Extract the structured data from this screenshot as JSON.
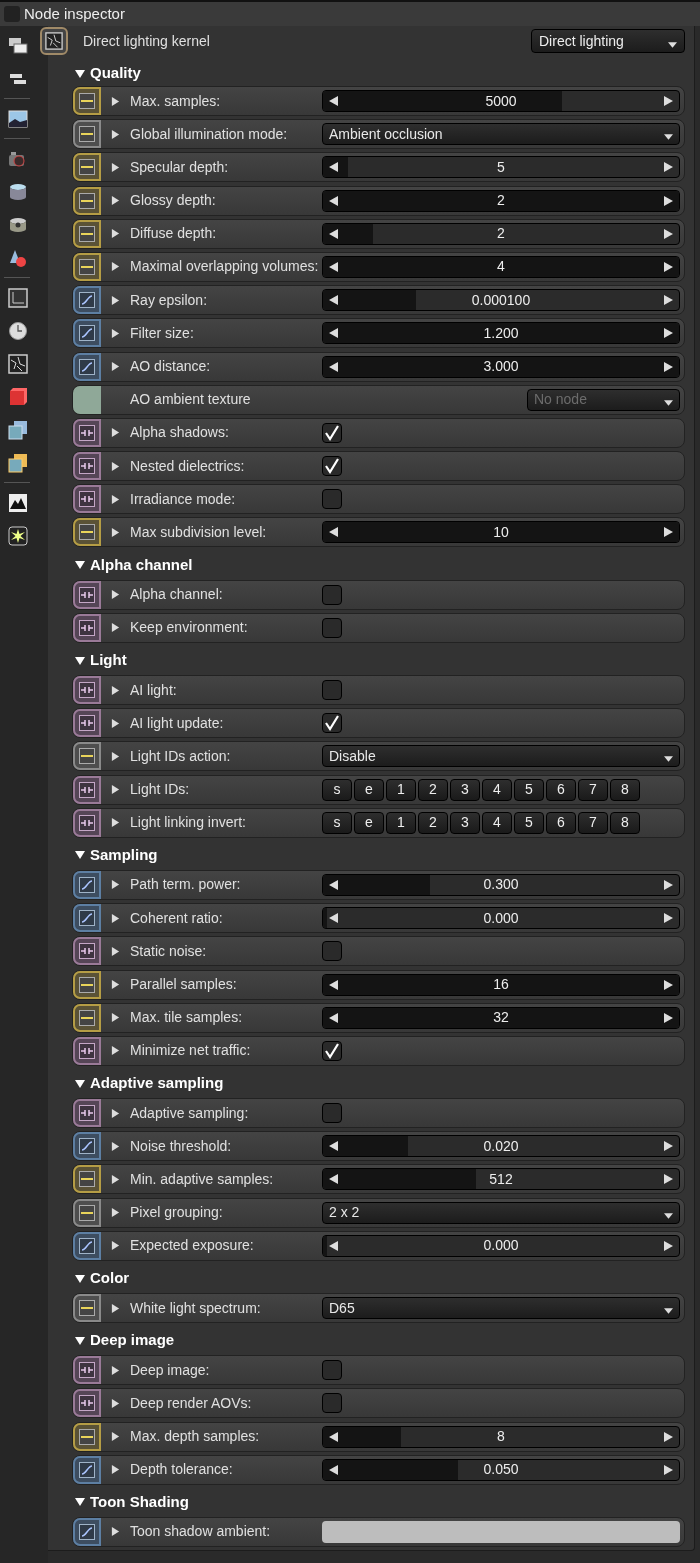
{
  "window": {
    "title": "Node inspector"
  },
  "node": {
    "title": "Direct lighting kernel",
    "type": "Direct lighting"
  },
  "sections": [
    {
      "title": "Quality",
      "expanded": true,
      "rows": [
        {
          "kind": "slider",
          "pin": {
            "kind": "int"
          },
          "label": "Max. samples:",
          "value": "5000",
          "level": 0.67
        },
        {
          "kind": "dropdown",
          "pin": {
            "kind": "enum"
          },
          "label": "Global illumination mode:",
          "value": "Ambient occlusion",
          "disabled": false
        },
        {
          "kind": "slider",
          "pin": {
            "kind": "int"
          },
          "label": "Specular depth:",
          "value": "5",
          "level": 0.07
        },
        {
          "kind": "slider",
          "pin": {
            "kind": "int"
          },
          "label": "Glossy depth:",
          "value": "2",
          "level": 1
        },
        {
          "kind": "slider",
          "pin": {
            "kind": "int"
          },
          "label": "Diffuse depth:",
          "value": "2",
          "level": 0.14
        },
        {
          "kind": "slider",
          "pin": {
            "kind": "int"
          },
          "label": "Maximal overlapping volumes:",
          "value": "4",
          "level": 1
        },
        {
          "kind": "slider",
          "pin": {
            "kind": "float"
          },
          "label": "Ray epsilon:",
          "value": "0.000100",
          "level": 0.26
        },
        {
          "kind": "slider",
          "pin": {
            "kind": "float"
          },
          "label": "Filter size:",
          "value": "1.200",
          "level": 1
        },
        {
          "kind": "slider",
          "pin": {
            "kind": "float"
          },
          "label": "AO distance:",
          "value": "3.000",
          "level": 1
        },
        {
          "kind": "texture",
          "pin": {
            "kind": "texture"
          },
          "label": "AO ambient texture",
          "value": "No node",
          "disabled": true
        },
        {
          "kind": "checkbox",
          "pin": {
            "kind": "bool"
          },
          "label": "Alpha shadows:",
          "checked": true
        },
        {
          "kind": "checkbox",
          "pin": {
            "kind": "bool"
          },
          "label": "Nested dielectrics:",
          "checked": true
        },
        {
          "kind": "checkbox",
          "pin": {
            "kind": "bool"
          },
          "label": "Irradiance mode:",
          "checked": false
        },
        {
          "kind": "slider",
          "pin": {
            "kind": "int"
          },
          "label": "Max subdivision level:",
          "value": "10",
          "level": 1
        }
      ]
    },
    {
      "title": "Alpha channel",
      "expanded": true,
      "rows": [
        {
          "kind": "checkbox",
          "pin": {
            "kind": "bool"
          },
          "label": "Alpha channel:",
          "checked": false
        },
        {
          "kind": "checkbox",
          "pin": {
            "kind": "bool"
          },
          "label": "Keep environment:",
          "checked": false
        }
      ]
    },
    {
      "title": "Light",
      "expanded": true,
      "rows": [
        {
          "kind": "checkbox",
          "pin": {
            "kind": "bool"
          },
          "label": "AI light:",
          "checked": false
        },
        {
          "kind": "checkbox",
          "pin": {
            "kind": "bool"
          },
          "label": "AI light update:",
          "checked": true
        },
        {
          "kind": "dropdown",
          "pin": {
            "kind": "enum"
          },
          "label": "Light IDs action:",
          "value": "Disable",
          "disabled": false
        },
        {
          "kind": "ids",
          "pin": {
            "kind": "bool"
          },
          "label": "Light IDs:",
          "buttons": [
            "s",
            "e",
            "1",
            "2",
            "3",
            "4",
            "5",
            "6",
            "7",
            "8"
          ]
        },
        {
          "kind": "ids",
          "pin": {
            "kind": "bool"
          },
          "label": "Light linking invert:",
          "buttons": [
            "s",
            "e",
            "1",
            "2",
            "3",
            "4",
            "5",
            "6",
            "7",
            "8"
          ]
        }
      ]
    },
    {
      "title": "Sampling",
      "expanded": true,
      "rows": [
        {
          "kind": "slider",
          "pin": {
            "kind": "float"
          },
          "label": "Path term. power:",
          "value": "0.300",
          "level": 0.3
        },
        {
          "kind": "slider",
          "pin": {
            "kind": "float"
          },
          "label": "Coherent ratio:",
          "value": "0.000",
          "level": 0
        },
        {
          "kind": "checkbox",
          "pin": {
            "kind": "bool"
          },
          "label": "Static noise:",
          "checked": false
        },
        {
          "kind": "slider",
          "pin": {
            "kind": "int"
          },
          "label": "Parallel samples:",
          "value": "16",
          "level": 1
        },
        {
          "kind": "slider",
          "pin": {
            "kind": "int"
          },
          "label": "Max. tile samples:",
          "value": "32",
          "level": 1
        },
        {
          "kind": "checkbox",
          "pin": {
            "kind": "bool"
          },
          "label": "Minimize net traffic:",
          "checked": true
        }
      ]
    },
    {
      "title": "Adaptive sampling",
      "expanded": true,
      "rows": [
        {
          "kind": "checkbox",
          "pin": {
            "kind": "bool"
          },
          "label": "Adaptive sampling:",
          "checked": false
        },
        {
          "kind": "slider",
          "pin": {
            "kind": "float"
          },
          "label": "Noise threshold:",
          "value": "0.020",
          "level": 0.24
        },
        {
          "kind": "slider",
          "pin": {
            "kind": "int"
          },
          "label": "Min. adaptive samples:",
          "value": "512",
          "level": 0.43
        },
        {
          "kind": "dropdown",
          "pin": {
            "kind": "enum"
          },
          "label": "Pixel grouping:",
          "value": "2 x 2",
          "disabled": false
        },
        {
          "kind": "slider",
          "pin": {
            "kind": "float"
          },
          "label": "Expected exposure:",
          "value": "0.000",
          "level": 0
        }
      ]
    },
    {
      "title": "Color",
      "expanded": true,
      "rows": [
        {
          "kind": "dropdown",
          "pin": {
            "kind": "enum"
          },
          "label": "White light spectrum:",
          "value": "D65",
          "disabled": false
        }
      ]
    },
    {
      "title": "Deep image",
      "expanded": true,
      "rows": [
        {
          "kind": "checkbox",
          "pin": {
            "kind": "bool"
          },
          "label": "Deep image:",
          "checked": false
        },
        {
          "kind": "checkbox",
          "pin": {
            "kind": "bool"
          },
          "label": "Deep render AOVs:",
          "checked": false
        },
        {
          "kind": "slider",
          "pin": {
            "kind": "int"
          },
          "label": "Max. depth samples:",
          "value": "8",
          "level": 0.22
        },
        {
          "kind": "slider",
          "pin": {
            "kind": "float"
          },
          "label": "Depth tolerance:",
          "value": "0.050",
          "level": 0.38
        }
      ]
    },
    {
      "title": "Toon Shading",
      "expanded": true,
      "rows": [
        {
          "kind": "color",
          "pin": {
            "kind": "float"
          },
          "label": "Toon shadow ambient:",
          "color": "#bdbdbd"
        }
      ]
    }
  ]
}
